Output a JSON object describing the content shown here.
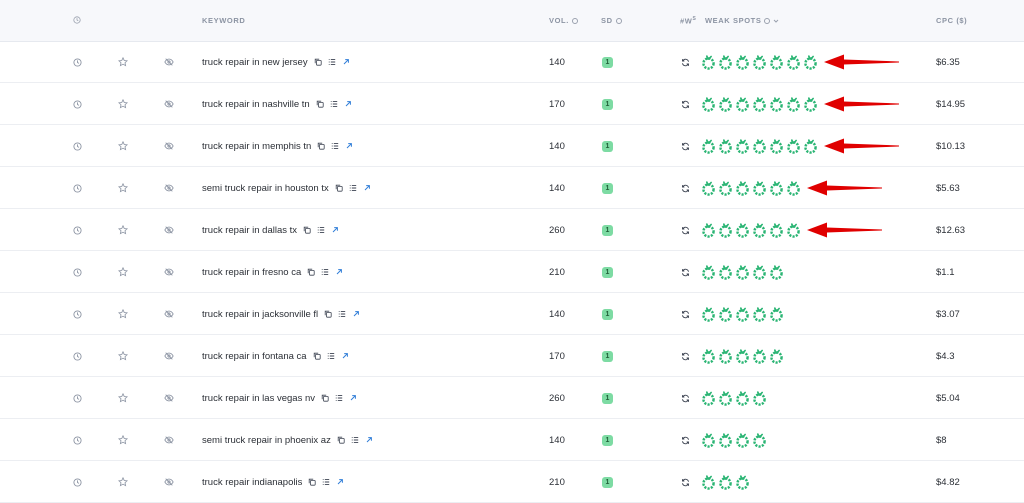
{
  "header": {
    "keyword": "KEYWORD",
    "vol": "VOL.",
    "sd": "SD",
    "hash": "#W",
    "hash_sup": "S",
    "weak_spots": "WEAK SPOTS",
    "cpc": "CPC ($)"
  },
  "colors": {
    "header_bg": "#f7f8fb",
    "sd_badge": "#7ddba3",
    "weak_spot_icon": "#2bb574",
    "arrow": "#e00000",
    "link_icon": "#2f7dd8"
  },
  "rows": [
    {
      "keyword": "truck repair in new jersey",
      "vol": "140",
      "sd": "1",
      "weak_spots": 7,
      "cpc": "$6.35",
      "arrow": true
    },
    {
      "keyword": "truck repair in nashville tn",
      "vol": "170",
      "sd": "1",
      "weak_spots": 7,
      "cpc": "$14.95",
      "arrow": true
    },
    {
      "keyword": "truck repair in memphis tn",
      "vol": "140",
      "sd": "1",
      "weak_spots": 7,
      "cpc": "$10.13",
      "arrow": true
    },
    {
      "keyword": "semi truck repair in houston tx",
      "vol": "140",
      "sd": "1",
      "weak_spots": 6,
      "cpc": "$5.63",
      "arrow": true
    },
    {
      "keyword": "truck repair in dallas tx",
      "vol": "260",
      "sd": "1",
      "weak_spots": 6,
      "cpc": "$12.63",
      "arrow": true
    },
    {
      "keyword": "truck repair in fresno ca",
      "vol": "210",
      "sd": "1",
      "weak_spots": 5,
      "cpc": "$1.1",
      "arrow": false
    },
    {
      "keyword": "truck repair in jacksonville fl",
      "vol": "140",
      "sd": "1",
      "weak_spots": 5,
      "cpc": "$3.07",
      "arrow": false
    },
    {
      "keyword": "truck repair in fontana ca",
      "vol": "170",
      "sd": "1",
      "weak_spots": 5,
      "cpc": "$4.3",
      "arrow": false
    },
    {
      "keyword": "truck repair in las vegas nv",
      "vol": "260",
      "sd": "1",
      "weak_spots": 4,
      "cpc": "$5.04",
      "arrow": false
    },
    {
      "keyword": "semi truck repair in phoenix az",
      "vol": "140",
      "sd": "1",
      "weak_spots": 4,
      "cpc": "$8",
      "arrow": false
    },
    {
      "keyword": "truck repair indianapolis",
      "vol": "210",
      "sd": "1",
      "weak_spots": 3,
      "cpc": "$4.82",
      "arrow": false
    }
  ]
}
